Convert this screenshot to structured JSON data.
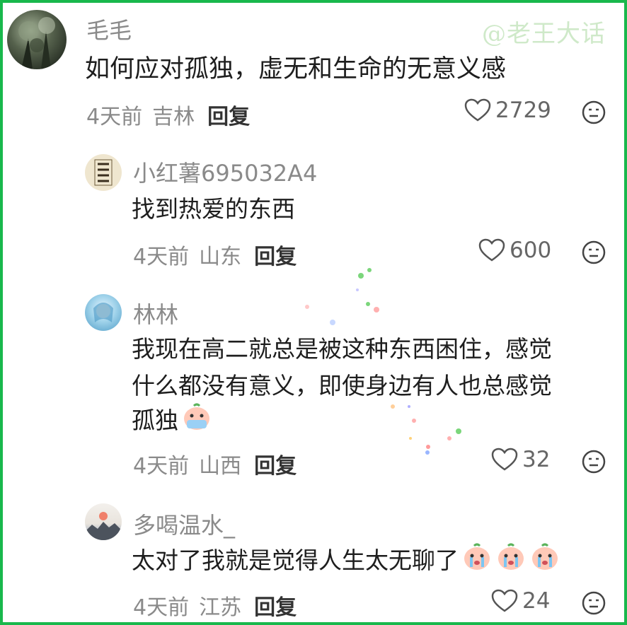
{
  "watermark": "@老王大话",
  "comments": [
    {
      "username": "毛毛",
      "text": "如何应对孤独，虚无和生命的无意义感",
      "time": "4天前",
      "location": "吉林",
      "reply_label": "回复",
      "likes": "2729"
    },
    {
      "username": "小红薯695032A4",
      "avatar_text": "招财进宝",
      "text": "找到热爱的东西",
      "time": "4天前",
      "location": "山东",
      "reply_label": "回复",
      "likes": "600"
    },
    {
      "username": "林林",
      "text_line1": "我现在高二就总是被这种东西困住，感觉",
      "text_line2": "什么都没有意义，即使身边有人也总感觉",
      "text_line3": "孤独",
      "time": "4天前",
      "location": "山西",
      "reply_label": "回复",
      "likes": "32"
    },
    {
      "username": "多喝温水_",
      "text": "太对了我就是觉得人生太无聊了",
      "time": "4天前",
      "location": "江苏",
      "reply_label": "回复",
      "likes": "24"
    }
  ],
  "colors": {
    "frame": "#19b84c",
    "username": "#8a8a8a",
    "text": "#1e1e1e",
    "reply": "#333333"
  }
}
